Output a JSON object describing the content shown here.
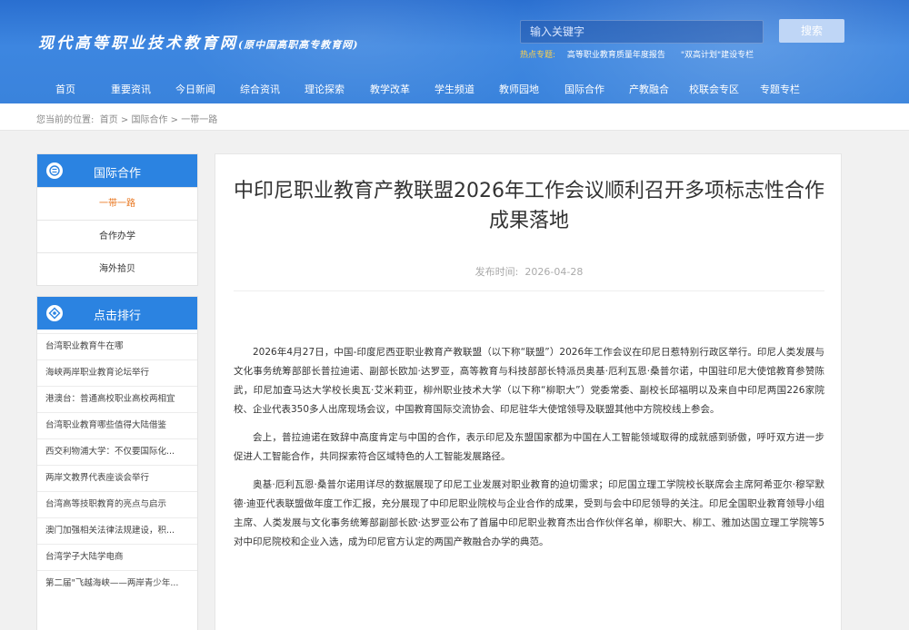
{
  "header": {
    "logo_main": "现代高等职业技术教育网",
    "logo_sub": "(原中国高职高专教育网)",
    "search_placeholder": "输入关键字",
    "search_button": "搜索",
    "hot_label": "热点专题:",
    "hot_links": [
      "高等职业教育质量年度报告",
      "\"双高计划\"建设专栏"
    ]
  },
  "nav": [
    "首页",
    "重要资讯",
    "今日新闻",
    "综合资讯",
    "理论探索",
    "教学改革",
    "学生频道",
    "教师园地",
    "国际合作",
    "产教融合",
    "校联会专区",
    "专题专栏"
  ],
  "breadcrumb": {
    "prefix": "您当前的位置:",
    "path": "首页 > 国际合作 > 一带一路"
  },
  "sidebar": {
    "category_title": "国际合作",
    "menu": [
      "一带一路",
      "合作办学",
      "海外拾贝"
    ],
    "ranking_title": "点击排行",
    "ranking": [
      "台湾职业教育牛在哪",
      "海峡两岸职业教育论坛举行",
      "港澳台：普通高校职业高校两相宜",
      "台湾职业教育哪些值得大陆借鉴",
      "西交利物浦大学：不仅要国际化...",
      "两岸文教界代表座谈会举行",
      "台湾高等技职教育的亮点与启示",
      "澳门加强相关法律法规建设，积...",
      "台湾学子大陆学电商",
      "第二届\"飞越海峡——两岸青少年..."
    ]
  },
  "article": {
    "title": "中印尼职业教育产教联盟2026年工作会议顺利召开多项标志性合作成果落地",
    "date_label": "发布时间:",
    "date": "2026-04-28",
    "paragraphs": [
      "2026年4月27日，中国-印度尼西亚职业教育产教联盟（以下称“联盟”）2026年工作会议在印尼日惹特别行政区举行。印尼人类发展与文化事务统筹部部长普拉迪诺、副部长欧加·达罗亚，高等教育与科技部部长特派员奥基·厄利瓦恩·桑普尔诺，中国驻印尼大使馆教育参赞陈武，印尼加查马达大学校长奥瓦·艾米莉亚，柳州职业技术大学（以下称“柳职大”）党委常委、副校长邱福明以及来自中印尼两国226家院校、企业代表350多人出席现场会议，中国教育国际交流协会、印尼驻华大使馆领导及联盟其他中方院校线上参会。",
      "会上，普拉迪诺在致辞中高度肯定与中国的合作，表示印尼及东盟国家都为中国在人工智能领域取得的成就感到骄傲，呼吁双方进一步促进人工智能合作，共同探索符合区域特色的人工智能发展路径。",
      "奥基·厄利瓦恩·桑普尔诺用详尽的数据展现了印尼工业发展对职业教育的迫切需求；印尼国立理工学院校长联席会主席阿希亚尔·穆罕默德·迪亚代表联盟做年度工作汇报，充分展现了中印尼职业院校与企业合作的成果，受到与会中印尼领导的关注。印尼全国职业教育领导小组主席、人类发展与文化事务统筹部副部长欧·达罗亚公布了首届中印尼职业教育杰出合作伙伴名单，柳职大、柳工、雅加达国立理工学院等5对中印尼院校和企业入选，成为印尼官方认定的两国产教融合办学的典范。"
    ]
  }
}
